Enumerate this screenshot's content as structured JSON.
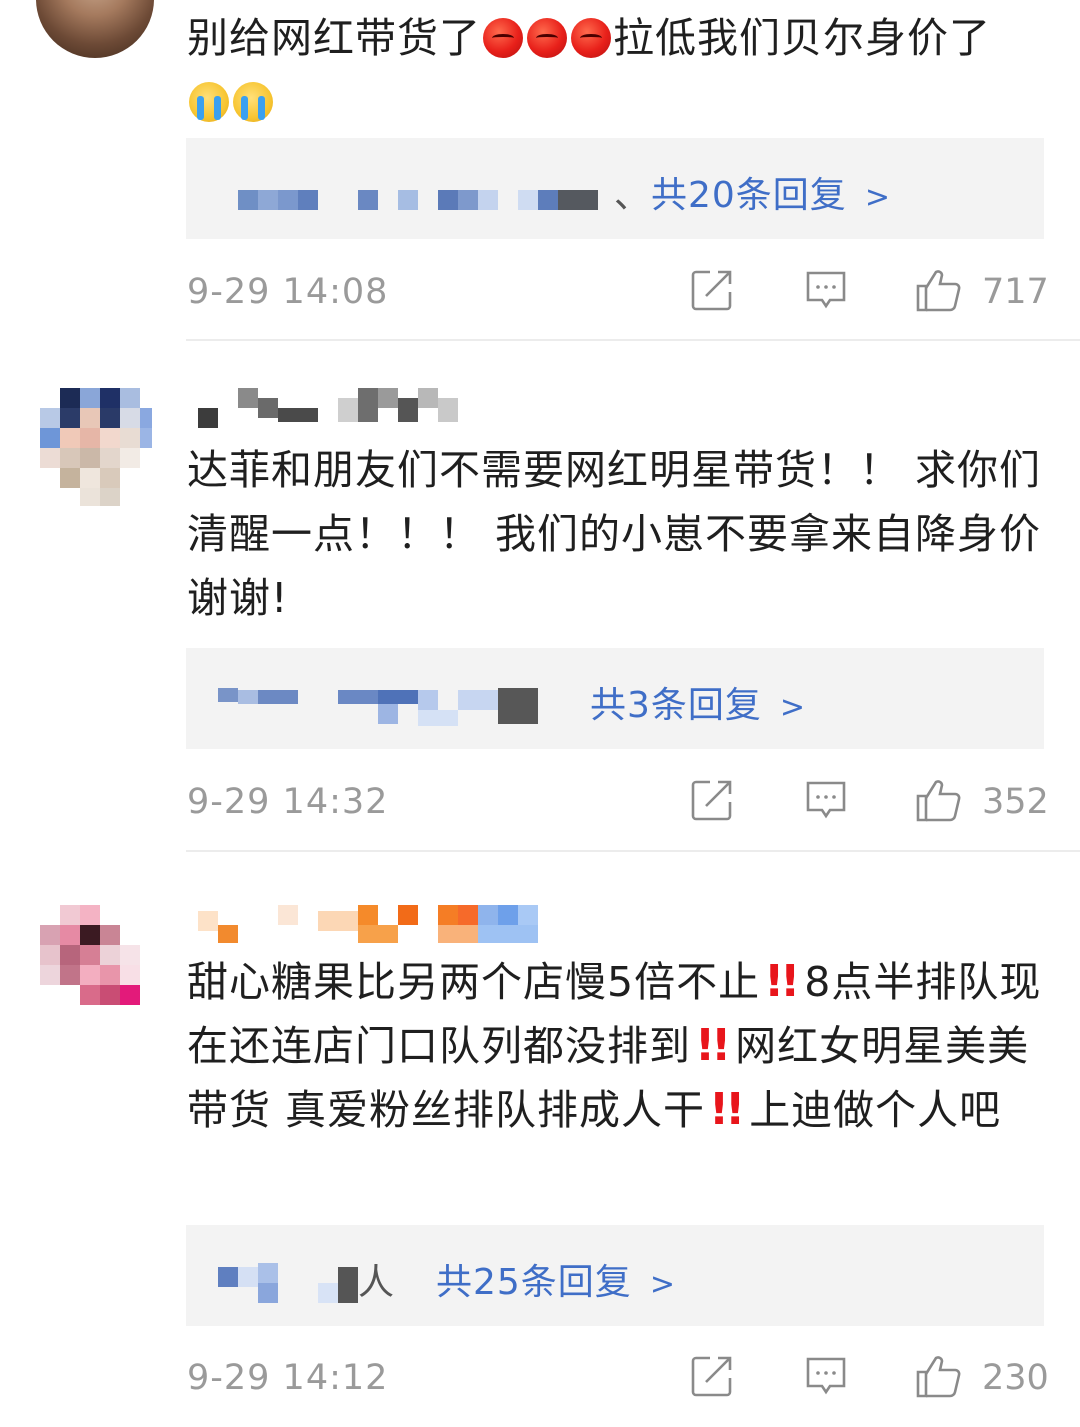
{
  "comments": [
    {
      "text_a": "别给网红带货了",
      "text_b": "拉低我们贝尔身价了",
      "reply_sep": "、",
      "reply_link": "共20条回复",
      "date": "9-29 14:08",
      "likes": "717"
    },
    {
      "text": "达菲和朋友们不需要网红明星带货！！ 求你们清醒一点！！！ 我们的小崽不要拿来自降身价谢谢!",
      "reply_link": "共3条回复",
      "date": "9-29 14:32",
      "likes": "352"
    },
    {
      "text_a": "甜心糖果比另两个店慢5倍不止",
      "text_b": "8点半排队现在还连店门口队列都没排到",
      "text_c": "网红女明星美美带货 真爱粉丝排队排成人干",
      "text_d": "上迪做个人吧",
      "reply_suffix": "人",
      "reply_link": "共25条回复",
      "date": "9-29 14:12",
      "likes": "230"
    }
  ],
  "icons": {
    "share": "share-icon",
    "comment": "comment-icon",
    "like": "thumbs-up-icon",
    "chevron": "chevron-right-icon"
  },
  "colors": {
    "link": "#3f6ec7",
    "meta": "#9a9a9a",
    "reply_bg": "#f3f3f3",
    "alert": "#e8151b"
  }
}
